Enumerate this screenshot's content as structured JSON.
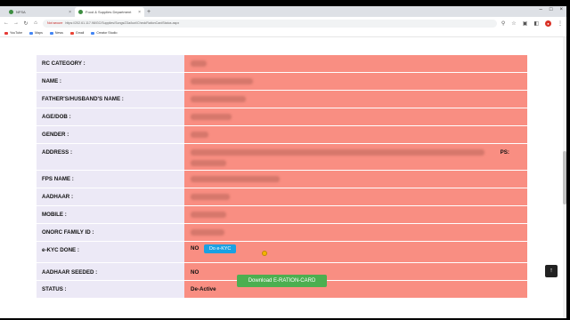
{
  "browser": {
    "tabs": [
      {
        "label": "NFSA",
        "active": false
      },
      {
        "label": "Food & Supplies Department",
        "active": true
      }
    ],
    "address": {
      "security_label": "Not secure",
      "url": "https://202.61.117.98/GC/Supplies/Songs/23a/kuri/CheckRationCardStatus.aspx"
    },
    "bookmarks": [
      "YouTube",
      "Maps",
      "News",
      "Gmail",
      "Creator Studio"
    ]
  },
  "details": {
    "rows": [
      {
        "label": "RC CATEGORY :",
        "value": ""
      },
      {
        "label": "NAME :",
        "value": ""
      },
      {
        "label": "FATHER'S/HUSBAND'S NAME :",
        "value": ""
      },
      {
        "label": "AGE/DOB :",
        "value": ""
      },
      {
        "label": "GENDER :",
        "value": ""
      },
      {
        "label": "ADDRESS :",
        "value": "",
        "suffix": "PS:"
      },
      {
        "label": "FPS NAME :",
        "value": ""
      },
      {
        "label": "AADHAAR :",
        "value": ""
      },
      {
        "label": "MOBILE :",
        "value": ""
      },
      {
        "label": "ONORC FAMILY ID :",
        "value": ""
      },
      {
        "label": "e-KYC DONE :",
        "value": "NO",
        "button": "Do e-KYC"
      },
      {
        "label": "AADHAAR SEEDED :",
        "value": "NO"
      },
      {
        "label": "STATUS :",
        "value": "De-Active"
      }
    ]
  },
  "actions": {
    "download_label": "Download E-RATION-CARD"
  },
  "colors": {
    "label_bg": "#ece9f6",
    "value_bg": "#f98e82",
    "ekyc_button": "#1ba1e2",
    "download_button": "#4caf50"
  },
  "icons": [
    "back-icon",
    "forward-icon",
    "reload-icon",
    "home-icon",
    "star-icon",
    "extensions-icon",
    "profile-icon",
    "scroll-top-icon"
  ]
}
